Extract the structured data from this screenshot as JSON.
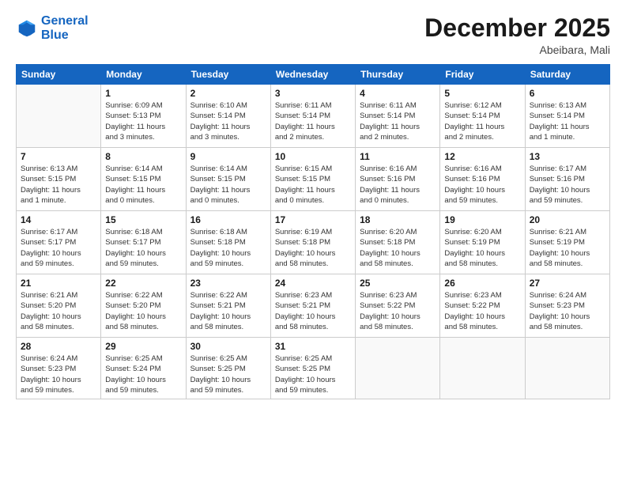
{
  "logo": {
    "line1": "General",
    "line2": "Blue"
  },
  "title": "December 2025",
  "location": "Abeibara, Mali",
  "days_header": [
    "Sunday",
    "Monday",
    "Tuesday",
    "Wednesday",
    "Thursday",
    "Friday",
    "Saturday"
  ],
  "weeks": [
    [
      {
        "day": "",
        "info": ""
      },
      {
        "day": "1",
        "info": "Sunrise: 6:09 AM\nSunset: 5:13 PM\nDaylight: 11 hours\nand 3 minutes."
      },
      {
        "day": "2",
        "info": "Sunrise: 6:10 AM\nSunset: 5:14 PM\nDaylight: 11 hours\nand 3 minutes."
      },
      {
        "day": "3",
        "info": "Sunrise: 6:11 AM\nSunset: 5:14 PM\nDaylight: 11 hours\nand 2 minutes."
      },
      {
        "day": "4",
        "info": "Sunrise: 6:11 AM\nSunset: 5:14 PM\nDaylight: 11 hours\nand 2 minutes."
      },
      {
        "day": "5",
        "info": "Sunrise: 6:12 AM\nSunset: 5:14 PM\nDaylight: 11 hours\nand 2 minutes."
      },
      {
        "day": "6",
        "info": "Sunrise: 6:13 AM\nSunset: 5:14 PM\nDaylight: 11 hours\nand 1 minute."
      }
    ],
    [
      {
        "day": "7",
        "info": "Sunrise: 6:13 AM\nSunset: 5:15 PM\nDaylight: 11 hours\nand 1 minute."
      },
      {
        "day": "8",
        "info": "Sunrise: 6:14 AM\nSunset: 5:15 PM\nDaylight: 11 hours\nand 0 minutes."
      },
      {
        "day": "9",
        "info": "Sunrise: 6:14 AM\nSunset: 5:15 PM\nDaylight: 11 hours\nand 0 minutes."
      },
      {
        "day": "10",
        "info": "Sunrise: 6:15 AM\nSunset: 5:15 PM\nDaylight: 11 hours\nand 0 minutes."
      },
      {
        "day": "11",
        "info": "Sunrise: 6:16 AM\nSunset: 5:16 PM\nDaylight: 11 hours\nand 0 minutes."
      },
      {
        "day": "12",
        "info": "Sunrise: 6:16 AM\nSunset: 5:16 PM\nDaylight: 10 hours\nand 59 minutes."
      },
      {
        "day": "13",
        "info": "Sunrise: 6:17 AM\nSunset: 5:16 PM\nDaylight: 10 hours\nand 59 minutes."
      }
    ],
    [
      {
        "day": "14",
        "info": "Sunrise: 6:17 AM\nSunset: 5:17 PM\nDaylight: 10 hours\nand 59 minutes."
      },
      {
        "day": "15",
        "info": "Sunrise: 6:18 AM\nSunset: 5:17 PM\nDaylight: 10 hours\nand 59 minutes."
      },
      {
        "day": "16",
        "info": "Sunrise: 6:18 AM\nSunset: 5:18 PM\nDaylight: 10 hours\nand 59 minutes."
      },
      {
        "day": "17",
        "info": "Sunrise: 6:19 AM\nSunset: 5:18 PM\nDaylight: 10 hours\nand 58 minutes."
      },
      {
        "day": "18",
        "info": "Sunrise: 6:20 AM\nSunset: 5:18 PM\nDaylight: 10 hours\nand 58 minutes."
      },
      {
        "day": "19",
        "info": "Sunrise: 6:20 AM\nSunset: 5:19 PM\nDaylight: 10 hours\nand 58 minutes."
      },
      {
        "day": "20",
        "info": "Sunrise: 6:21 AM\nSunset: 5:19 PM\nDaylight: 10 hours\nand 58 minutes."
      }
    ],
    [
      {
        "day": "21",
        "info": "Sunrise: 6:21 AM\nSunset: 5:20 PM\nDaylight: 10 hours\nand 58 minutes."
      },
      {
        "day": "22",
        "info": "Sunrise: 6:22 AM\nSunset: 5:20 PM\nDaylight: 10 hours\nand 58 minutes."
      },
      {
        "day": "23",
        "info": "Sunrise: 6:22 AM\nSunset: 5:21 PM\nDaylight: 10 hours\nand 58 minutes."
      },
      {
        "day": "24",
        "info": "Sunrise: 6:23 AM\nSunset: 5:21 PM\nDaylight: 10 hours\nand 58 minutes."
      },
      {
        "day": "25",
        "info": "Sunrise: 6:23 AM\nSunset: 5:22 PM\nDaylight: 10 hours\nand 58 minutes."
      },
      {
        "day": "26",
        "info": "Sunrise: 6:23 AM\nSunset: 5:22 PM\nDaylight: 10 hours\nand 58 minutes."
      },
      {
        "day": "27",
        "info": "Sunrise: 6:24 AM\nSunset: 5:23 PM\nDaylight: 10 hours\nand 58 minutes."
      }
    ],
    [
      {
        "day": "28",
        "info": "Sunrise: 6:24 AM\nSunset: 5:23 PM\nDaylight: 10 hours\nand 59 minutes."
      },
      {
        "day": "29",
        "info": "Sunrise: 6:25 AM\nSunset: 5:24 PM\nDaylight: 10 hours\nand 59 minutes."
      },
      {
        "day": "30",
        "info": "Sunrise: 6:25 AM\nSunset: 5:25 PM\nDaylight: 10 hours\nand 59 minutes."
      },
      {
        "day": "31",
        "info": "Sunrise: 6:25 AM\nSunset: 5:25 PM\nDaylight: 10 hours\nand 59 minutes."
      },
      {
        "day": "",
        "info": ""
      },
      {
        "day": "",
        "info": ""
      },
      {
        "day": "",
        "info": ""
      }
    ]
  ]
}
